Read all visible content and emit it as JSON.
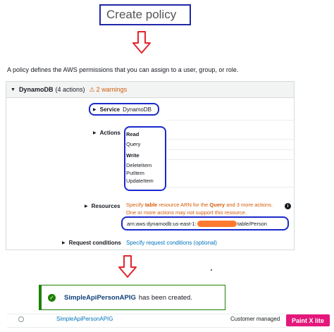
{
  "title": "Create policy",
  "intro": "A policy defines the AWS permissions that you can assign to a user, group, or role.",
  "panel": {
    "service_name": "DynamoDB",
    "action_count": "(4 actions)",
    "warnings": "2 warnings",
    "service_label": "Service",
    "service_value": "DynamoDB",
    "actions_label": "Actions",
    "action_groups": [
      {
        "heading": "Read",
        "items": [
          "Query"
        ]
      },
      {
        "heading": "Write",
        "items": [
          "DeleteItem",
          "PutItem",
          "UpdateItem"
        ]
      }
    ],
    "resources_label": "Resources",
    "resources_warning_1_pre": "Specify ",
    "resources_warning_1_bold1": "table",
    "resources_warning_1_mid": " resource ARN for the ",
    "resources_warning_1_bold2": "Query",
    "resources_warning_1_post": " and 3 more actions.",
    "resources_warning_2": "One or more actions may not support this resource.",
    "arn_prefix": "arn:aws:dynamodb:us-east-1:",
    "arn_suffix": "table/Person",
    "request_conditions_label": "Request conditions",
    "request_conditions_link": "Specify request conditions (optional)"
  },
  "success": {
    "policy_name": "SimpleApiPersonAPIG",
    "message": "has been created."
  },
  "policy_row": {
    "name": "SimpleApiPersonAPIG",
    "type": "Customer managed"
  },
  "watermark": "Paint X lite",
  "colors": {
    "annotation_blue": "#1a2acc",
    "arrow_red": "#e0262b",
    "warning_orange": "#d45b07",
    "link_blue": "#0073bb",
    "success_green": "#1d8102",
    "redaction_orange": "#ff7a2e"
  }
}
